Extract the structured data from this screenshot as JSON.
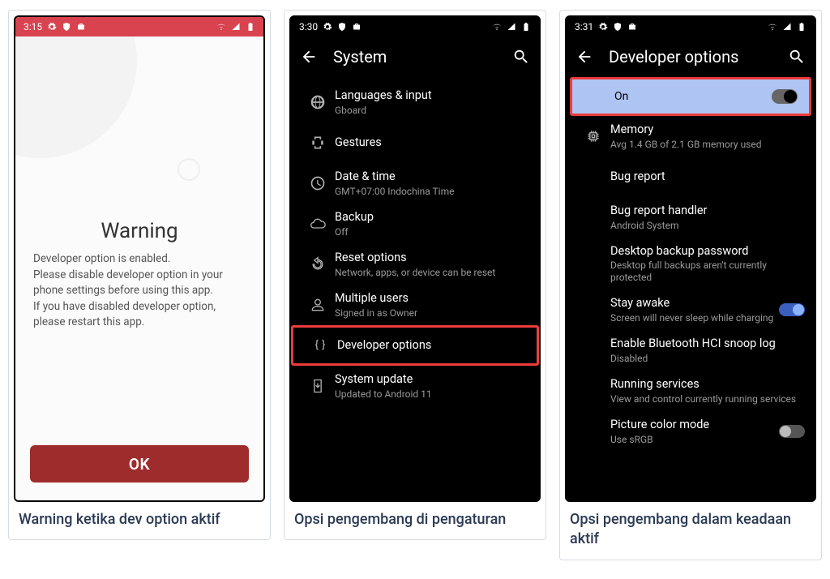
{
  "captions": {
    "panel1": "Warning ketika dev option aktif",
    "panel2": "Opsi pengembang di pengaturan",
    "panel3": "Opsi pengembang dalam keadaan aktif"
  },
  "times": {
    "panel1": "3:15",
    "panel2": "3:30",
    "panel3": "3:31"
  },
  "panel1": {
    "title": "Warning",
    "body": "Developer option is enabled.\nPlease disable developer option in your phone settings before using this app.\nIf you have disabled developer option, please restart this app.",
    "ok": "OK"
  },
  "panel2": {
    "header": "System",
    "items": [
      {
        "name": "languages",
        "label": "Languages & input",
        "sub": "Gboard",
        "icon": "globe"
      },
      {
        "name": "gestures",
        "label": "Gestures",
        "sub": "",
        "icon": "gestures"
      },
      {
        "name": "datetime",
        "label": "Date & time",
        "sub": "GMT+07:00 Indochina Time",
        "icon": "clock"
      },
      {
        "name": "backup",
        "label": "Backup",
        "sub": "Off",
        "icon": "cloud"
      },
      {
        "name": "reset",
        "label": "Reset options",
        "sub": "Network, apps, or device can be reset",
        "icon": "reset"
      },
      {
        "name": "multiusers",
        "label": "Multiple users",
        "sub": "Signed in as Owner",
        "icon": "user"
      },
      {
        "name": "devopts",
        "label": "Developer options",
        "sub": "",
        "icon": "braces",
        "highlight": true
      },
      {
        "name": "sysupdate",
        "label": "System update",
        "sub": "Updated to Android 11",
        "icon": "update"
      }
    ]
  },
  "panel3": {
    "header": "Developer options",
    "toggle_label": "On",
    "items": [
      {
        "name": "memory",
        "label": "Memory",
        "sub": "Avg 1.4 GB of 2.1 GB memory used",
        "icon": "chip"
      },
      {
        "name": "bugreport",
        "label": "Bug report",
        "sub": "",
        "icon": ""
      },
      {
        "name": "bughandler",
        "label": "Bug report handler",
        "sub": "Android System",
        "icon": ""
      },
      {
        "name": "desktopbackup",
        "label": "Desktop backup password",
        "sub": "Desktop full backups aren't currently protected",
        "icon": ""
      },
      {
        "name": "stayawake",
        "label": "Stay awake",
        "sub": "Screen will never sleep while charging",
        "icon": "",
        "switch": "on"
      },
      {
        "name": "btsnoop",
        "label": "Enable Bluetooth HCI snoop log",
        "sub": "Disabled",
        "icon": ""
      },
      {
        "name": "running",
        "label": "Running services",
        "sub": "View and control currently running services",
        "icon": ""
      },
      {
        "name": "colormode",
        "label": "Picture color mode",
        "sub": "Use sRGB",
        "icon": "",
        "switch": "off"
      }
    ]
  }
}
